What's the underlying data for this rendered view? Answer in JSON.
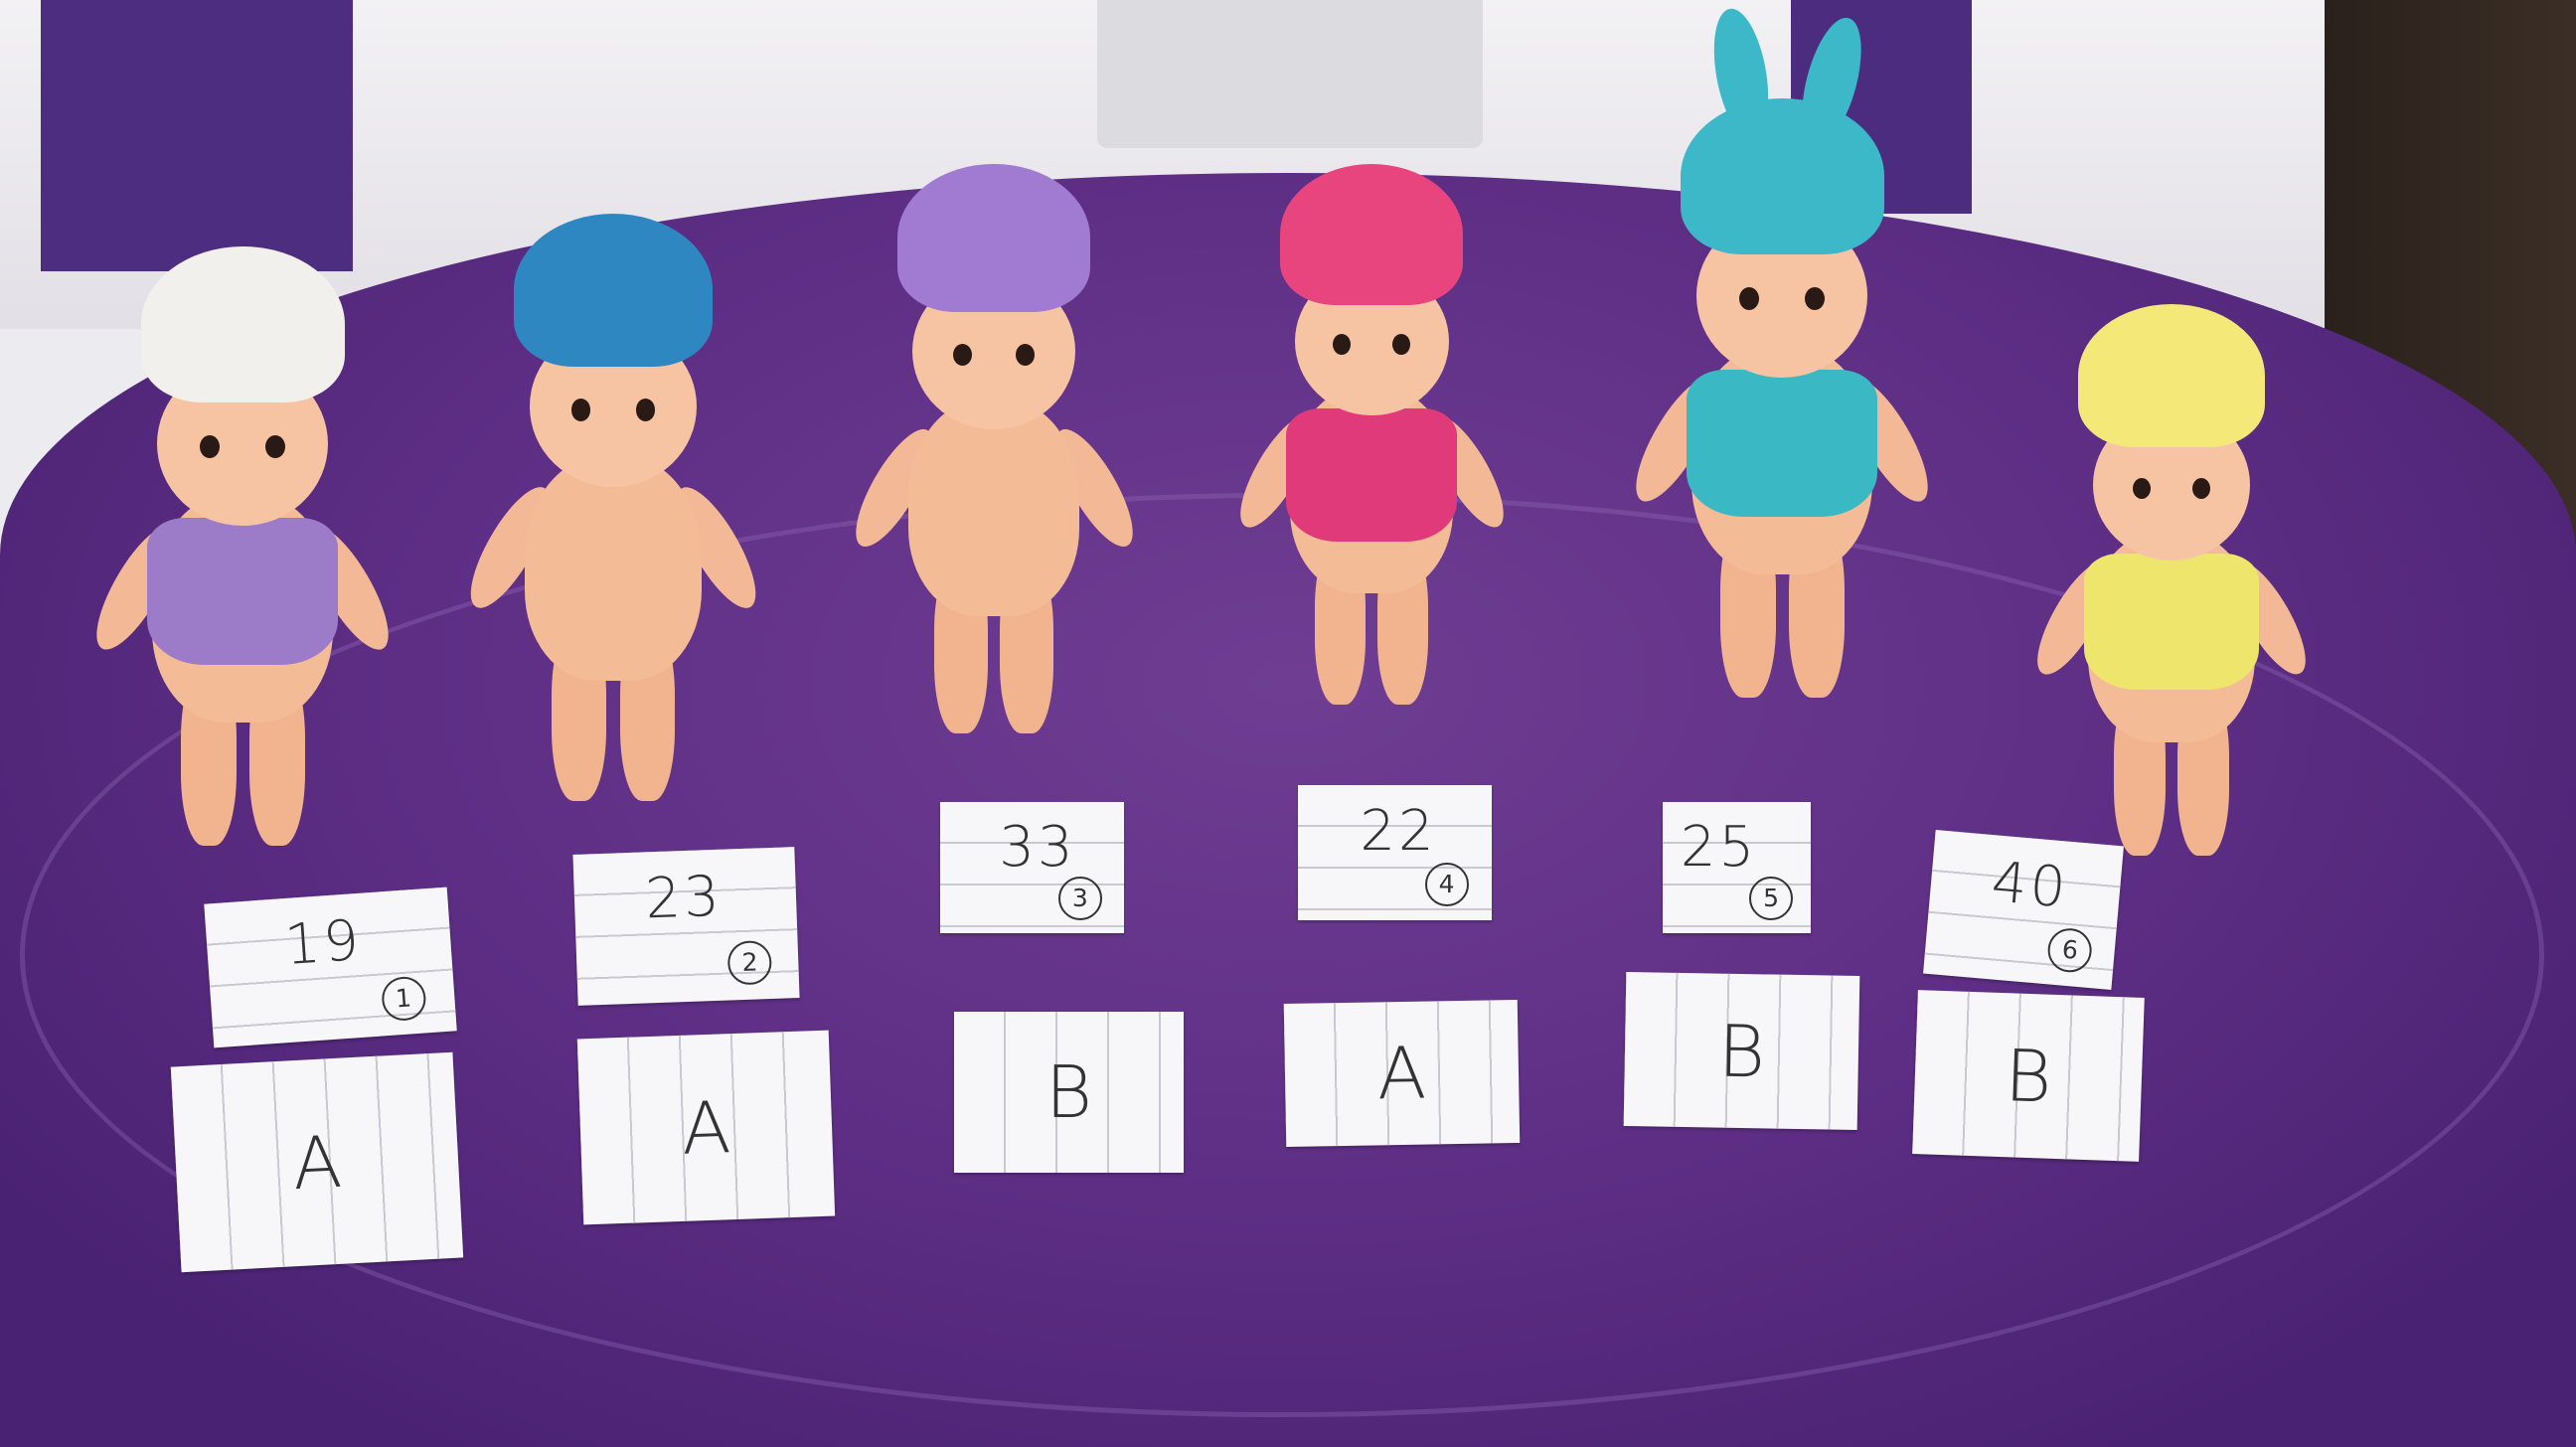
{
  "scene": {
    "colors": {
      "table": "#5f2f86",
      "wall": "#ecebef",
      "paper": "#f7f6f8"
    }
  },
  "figures": [
    {
      "hat_color": "#f2f0ec",
      "shirt_color": "#9c7bc9",
      "hat": "white-flower-cap"
    },
    {
      "hat_color": "#2f87c2",
      "shirt_color": "",
      "hat": "blue-bird-hood"
    },
    {
      "hat_color": "#a17bd1",
      "shirt_color": "",
      "hat": "purple-egg-cap"
    },
    {
      "hat_color": "#e8457e",
      "shirt_color": "#e13a7a",
      "hat": "easter-egg-hood"
    },
    {
      "hat_color": "#3cb8c9",
      "shirt_color": "#3ab9c4",
      "hat": "bunny-ear-hat"
    },
    {
      "hat_color": "#f3e878",
      "shirt_color": "#eee56d",
      "hat": "chick-hood"
    }
  ],
  "number_notes": [
    {
      "value": "19",
      "index": "1"
    },
    {
      "value": "23",
      "index": "2"
    },
    {
      "value": "33",
      "index": "3"
    },
    {
      "value": "22",
      "index": "4"
    },
    {
      "value": "25",
      "index": "5"
    },
    {
      "value": "40",
      "index": "6"
    }
  ],
  "letter_notes": [
    "A",
    "A",
    "B",
    "A",
    "B",
    "B"
  ]
}
